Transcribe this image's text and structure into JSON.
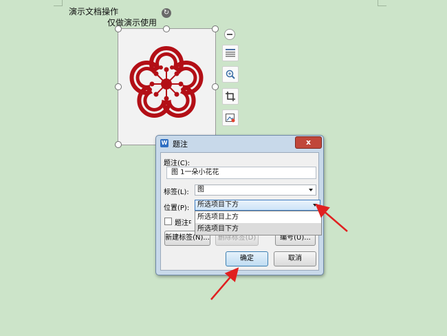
{
  "document": {
    "line1": "演示文档操作",
    "line2": "仅做演示使用"
  },
  "picture": {
    "description_icon": "plum-blossom-image",
    "flower_color": "#b30f16"
  },
  "side_tools": [
    "layout-icon",
    "zoom-icon",
    "crop-icon",
    "image-edit-icon"
  ],
  "dialog": {
    "title": "题注",
    "close_label": "x",
    "caption_label": "题注(C):",
    "caption_value": "图 1一朵小花花",
    "tag_label": "标签(L):",
    "tag_value": "图",
    "position_label": "位置(P):",
    "position_value": "所选项目下方",
    "position_options": [
      "所选项目上方",
      "所选项目下方"
    ],
    "checkbox_label": "题注中不包含标签(E)",
    "new_label_button": "新建标签(N)...",
    "delete_label_button": "删除标签(D)",
    "number_button": "编号(U)...",
    "ok_button": "确定",
    "cancel_button": "取消"
  },
  "colors": {
    "background": "#cce4c9",
    "annotation_arrow": "#e02020"
  }
}
